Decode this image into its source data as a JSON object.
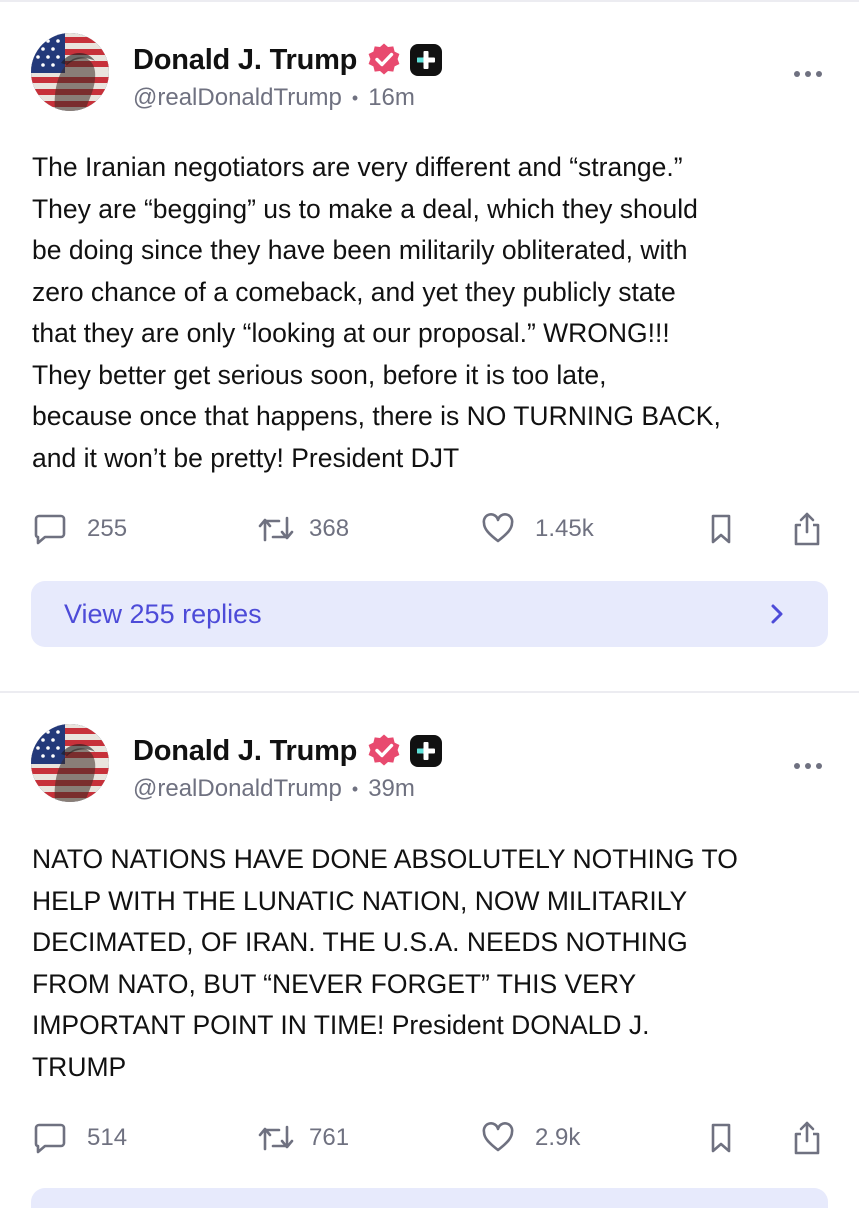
{
  "colors": {
    "text": "#111111",
    "muted": "#6f7180",
    "verified_badge": "#e84a6f",
    "plus_badge": "#111111",
    "plus_badge_accent": "#5ee0d8",
    "replies_bg": "#e7eafc",
    "replies_text": "#4d4bd8"
  },
  "icons": {
    "reply": "speech-bubble",
    "repost": "repost-arrows",
    "like": "heart-outline",
    "bookmark": "bookmark-outline",
    "share": "share-upload",
    "more": "three-dots",
    "verified": "verified-check-badge",
    "plus": "plus-badge",
    "chevron": "chevron-right"
  },
  "posts": [
    {
      "author": {
        "name": "Donald J. Trump",
        "handle": "@realDonaldTrump"
      },
      "time": "16m",
      "lines": [
        "The Iranian negotiators are very different and “strange.”",
        "They are “begging” us to make a deal, which they should",
        "be doing since they have been militarily obliterated, with",
        "zero chance of a comeback, and yet they publicly state",
        "that they are only “looking at our proposal.” WRONG!!!",
        "They better get serious soon, before it is too late,",
        "because once that happens, there is NO TURNING BACK,",
        "and it won’t be pretty! President DJT"
      ],
      "stats": {
        "replies": "255",
        "reposts": "368",
        "likes": "1.45k"
      },
      "view_replies_label": "View 255 replies"
    },
    {
      "author": {
        "name": "Donald J. Trump",
        "handle": "@realDonaldTrump"
      },
      "time": "39m",
      "lines": [
        "NATO NATIONS HAVE DONE ABSOLUTELY NOTHING TO",
        "HELP WITH THE LUNATIC NATION, NOW MILITARILY",
        "DECIMATED, OF IRAN. THE U.S.A. NEEDS NOTHING",
        "FROM NATO, BUT “NEVER FORGET” THIS VERY",
        "IMPORTANT POINT IN TIME! President DONALD J.",
        "TRUMP"
      ],
      "stats": {
        "replies": "514",
        "reposts": "761",
        "likes": "2.9k"
      }
    }
  ]
}
